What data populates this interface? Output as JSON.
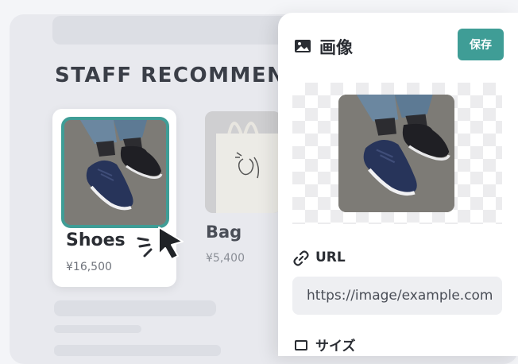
{
  "section": {
    "title": "STAFF RECOMMENDATIONS"
  },
  "products": [
    {
      "name": "Shoes",
      "price": "¥16,500"
    },
    {
      "name": "Bag",
      "price": "¥5,400"
    }
  ],
  "panel": {
    "title": "画像",
    "save_label": "保存",
    "url_label": "URL",
    "url_value": "https://image/example.com",
    "size_label": "サイズ"
  },
  "colors": {
    "accent": "#3f9d96"
  },
  "icons": [
    "image-icon",
    "link-icon",
    "size-icon",
    "cursor-icon"
  ]
}
